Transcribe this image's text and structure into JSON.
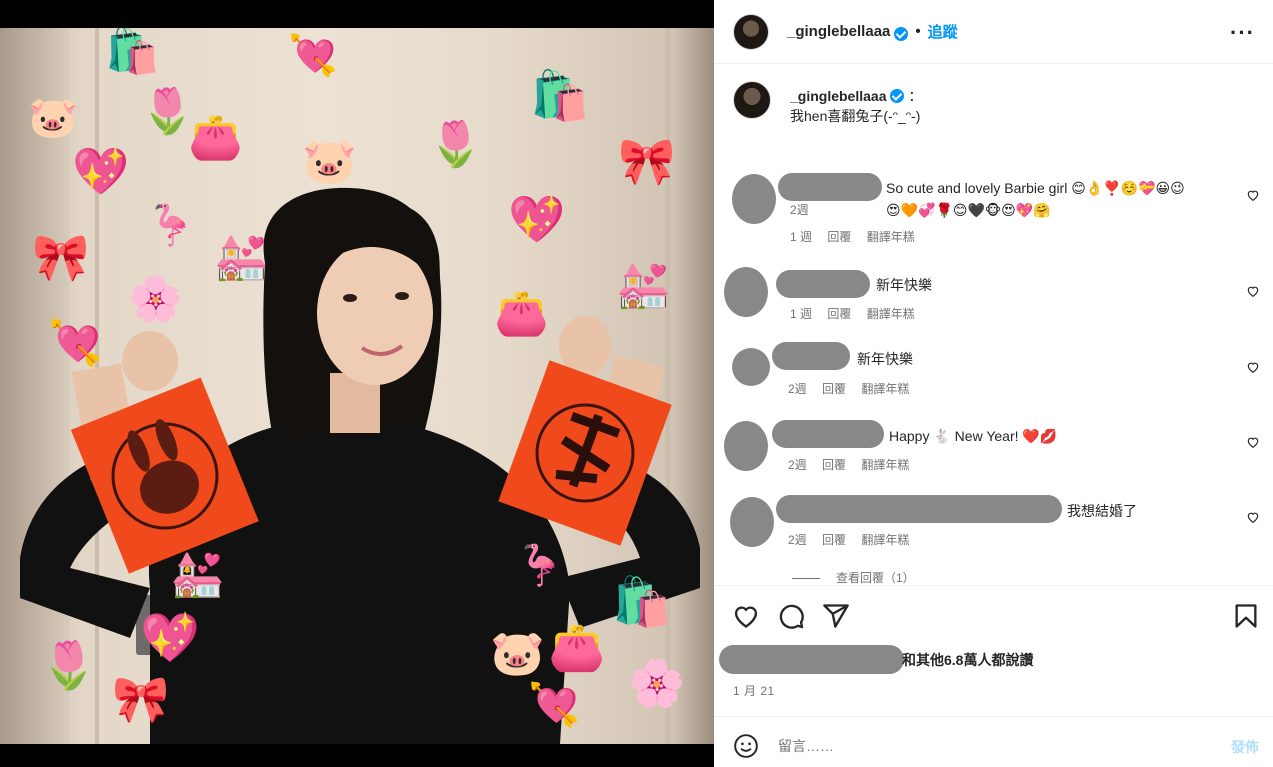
{
  "header": {
    "username": "_ginglebellaaa",
    "verified": true,
    "separator": "•",
    "follow_label": "追蹤",
    "more_label": "···"
  },
  "caption": {
    "username": "_ginglebellaaa",
    "colon": "：",
    "text": "我hen喜翻兔子(-ᵔ_ᵔ-)",
    "time": "2週"
  },
  "comments": [
    {
      "text": "So cute and lovely Barbie girl 😊👌❣️☺️💝😀😉",
      "text2": "😍🧡💞🌹😊🖤🐵😍💖🤗",
      "time": "1 週",
      "reply": "回覆",
      "translate": "翻譯年糕"
    },
    {
      "text": "新年快樂",
      "time": "1 週",
      "reply": "回覆",
      "translate": "翻譯年糕"
    },
    {
      "text": "新年快樂",
      "time": "2週",
      "reply": "回覆",
      "translate": "翻譯年糕"
    },
    {
      "text": "Happy 🐇 New Year! ❤️💋",
      "time": "2週",
      "reply": "回覆",
      "translate": "翻譯年糕"
    },
    {
      "text": "我想結婚了",
      "time": "2週",
      "reply": "回覆",
      "translate": "翻譯年糕"
    }
  ],
  "view_replies": "查看回覆（1）",
  "actions": {
    "like_icon": "heart-icon",
    "comment_icon": "comment-icon",
    "share_icon": "share-icon",
    "save_icon": "bookmark-icon"
  },
  "likes_text": "和其他6.8萬人都說讚",
  "date": "1 月 21",
  "composer": {
    "emoji_icon": "smile-icon",
    "placeholder": "留言……",
    "post_label": "發佈"
  },
  "colors": {
    "accent": "#0095f6",
    "post_disabled": "#b2dffc",
    "meta": "#737373"
  }
}
